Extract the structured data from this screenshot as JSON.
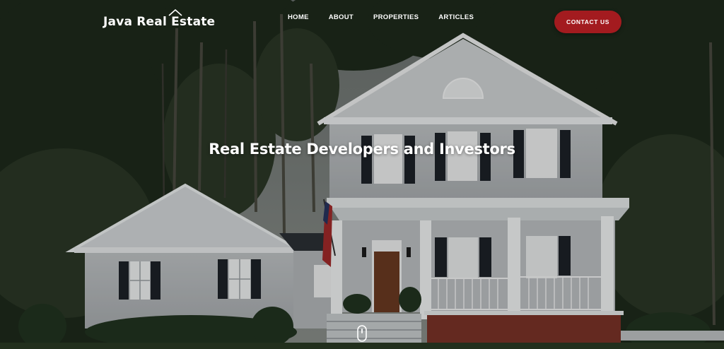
{
  "brand": {
    "name": "Java Real Estate",
    "logo_icon": "house-roof-icon"
  },
  "nav": {
    "items": [
      {
        "label": "HOME"
      },
      {
        "label": "ABOUT"
      },
      {
        "label": "PROPERTIES"
      },
      {
        "label": "ARTICLES"
      }
    ],
    "cta_label": "CONTACT US"
  },
  "hero": {
    "headline": "Real Estate Developers and Investors",
    "scroll_icon": "mouse-scroll-icon"
  },
  "colors": {
    "accent": "#a31b1f",
    "text": "#ffffff"
  }
}
